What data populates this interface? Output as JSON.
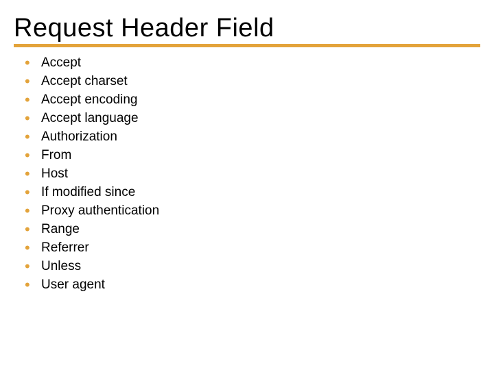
{
  "title": "Request Header Field",
  "colors": {
    "accent": "#e3a33a"
  },
  "items": [
    "Accept",
    "Accept charset",
    "Accept encoding",
    "Accept language",
    "Authorization",
    "From",
    "Host",
    "If modified since",
    "Proxy authentication",
    "Range",
    "Referrer",
    "Unless",
    "User agent"
  ]
}
